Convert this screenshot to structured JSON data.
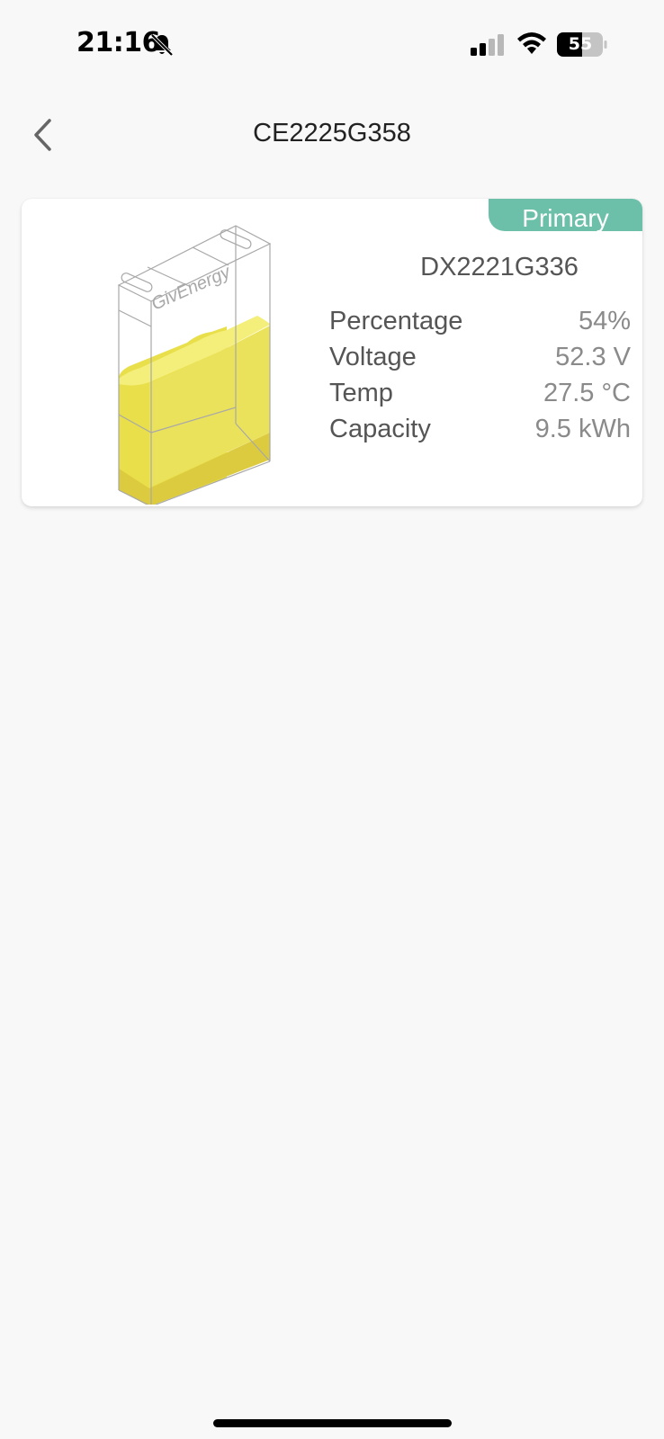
{
  "status_bar": {
    "time": "21:16",
    "battery_level": "55",
    "icons": [
      "bell-slash-icon",
      "cellular-signal-icon",
      "wifi-icon",
      "battery-icon"
    ]
  },
  "header": {
    "title": "CE2225G358",
    "back_icon": "chevron-left-icon"
  },
  "battery_card": {
    "badge": "Primary",
    "brand": "GivEnergy",
    "serial": "DX2221G336",
    "fill_level": 0.54,
    "fill_color": "#e8df4a",
    "badge_color": "#6cc0a9",
    "stats": [
      {
        "label": "Percentage",
        "value": "54%"
      },
      {
        "label": "Voltage",
        "value": "52.3 V"
      },
      {
        "label": "Temp",
        "value": "27.5 °C"
      },
      {
        "label": "Capacity",
        "value": "9.5 kWh"
      }
    ]
  }
}
